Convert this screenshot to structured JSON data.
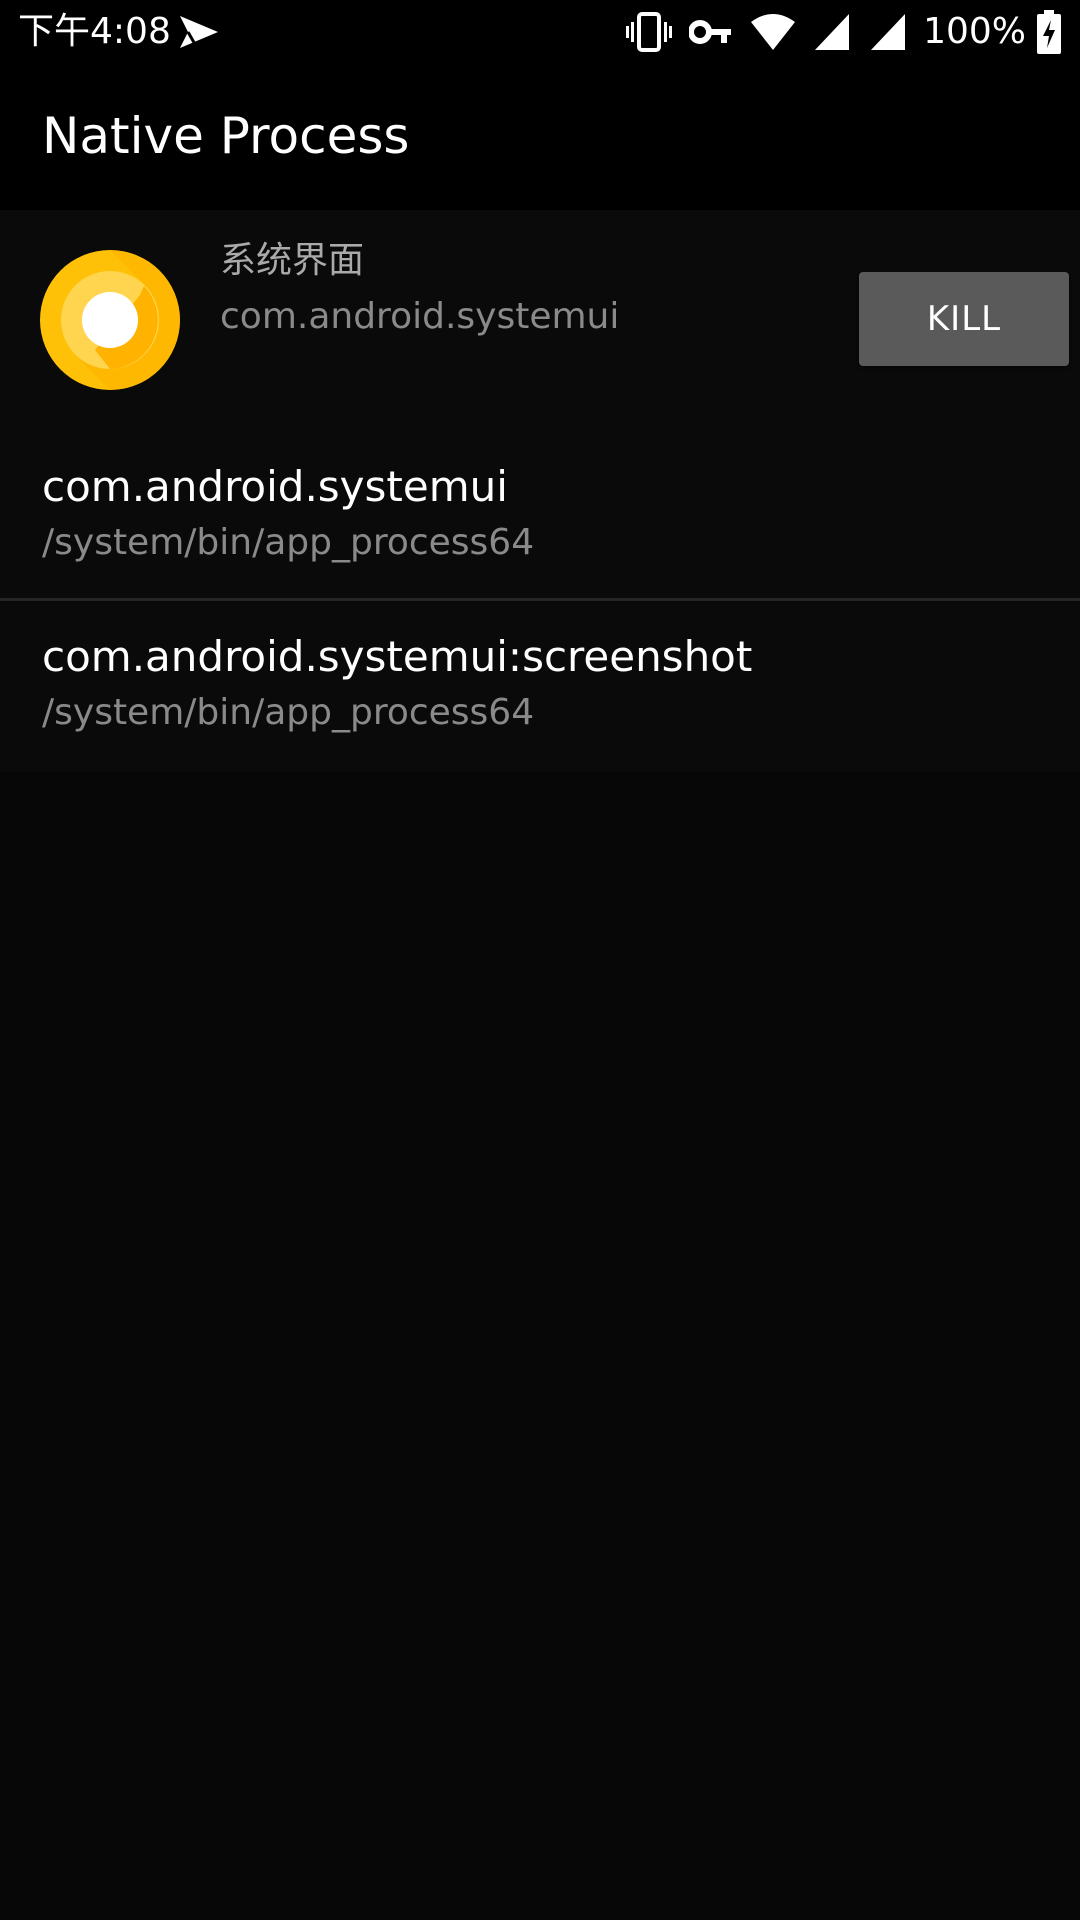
{
  "status_bar": {
    "time": "下午4:08",
    "battery_percent": "100%",
    "icons": [
      "navigation-icon",
      "vibrate-icon",
      "vpn-key-icon",
      "wifi-icon",
      "signal-icon",
      "signal-icon",
      "battery-charging-icon"
    ]
  },
  "app_bar": {
    "title": "Native Process"
  },
  "app_info": {
    "label": "系统界面",
    "package": "com.android.systemui",
    "kill_label": "KILL",
    "icon": "android-oreo-icon"
  },
  "processes": [
    {
      "name": "com.android.systemui",
      "path": "/system/bin/app_process64"
    },
    {
      "name": "com.android.systemui:screenshot",
      "path": "/system/bin/app_process64"
    }
  ],
  "colors": {
    "background": "#070707",
    "bar": "#000000",
    "button": "#5a5a5b",
    "secondary_text": "#8a8a8a",
    "icon_yellow": "#ffc107",
    "icon_orange": "#ff9800"
  }
}
